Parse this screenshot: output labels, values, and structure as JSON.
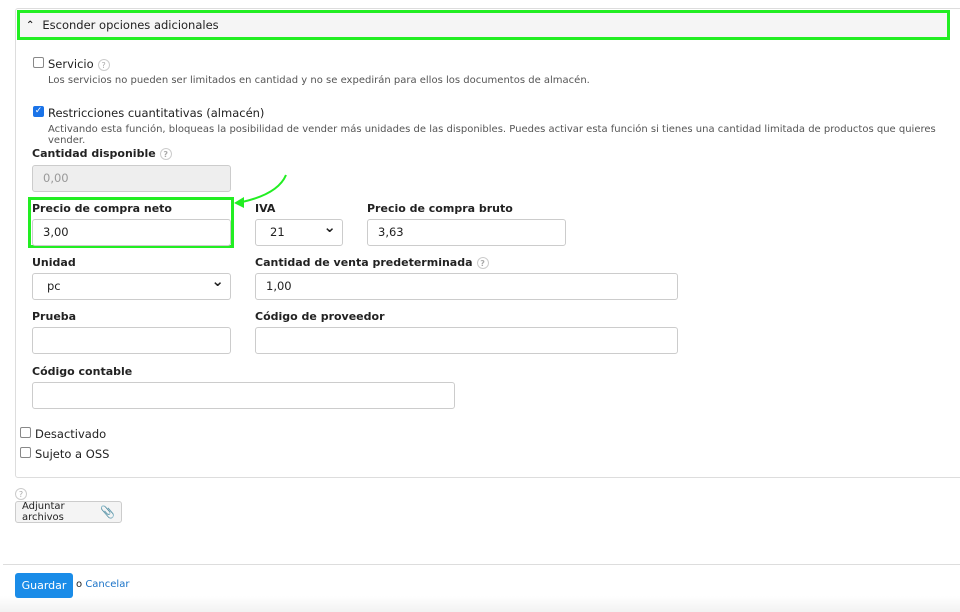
{
  "section": {
    "toggle_label": "Esconder opciones adicionales"
  },
  "servicio": {
    "label": "Servicio",
    "checked": false,
    "description": "Los servicios no pueden ser limitados en cantidad y no se expedirán para ellos los documentos de almacén."
  },
  "restricciones": {
    "label": "Restricciones cuantitativas (almacén)",
    "checked": true,
    "description": "Activando esta función, bloqueas la posibilidad de vender más unidades de las disponibles. Puedes activar esta función si tienes una cantidad limitada de productos que quieres vender."
  },
  "fields": {
    "cantidad_disponible": {
      "label": "Cantidad disponible",
      "value": "0,00"
    },
    "precio_neto": {
      "label": "Precio de compra neto",
      "value": "3,00"
    },
    "iva": {
      "label": "IVA",
      "value": "21"
    },
    "precio_bruto": {
      "label": "Precio de compra bruto",
      "value": "3,63"
    },
    "unidad": {
      "label": "Unidad",
      "value": "pc"
    },
    "cantidad_venta": {
      "label": "Cantidad de venta predeterminada",
      "value": "1,00"
    },
    "prueba": {
      "label": "Prueba",
      "value": ""
    },
    "codigo_proveedor": {
      "label": "Código de proveedor",
      "value": ""
    },
    "codigo_contable": {
      "label": "Código contable",
      "value": ""
    }
  },
  "desactivado": {
    "label": "Desactivado",
    "checked": false
  },
  "oss": {
    "label": "Sujeto a OSS",
    "checked": false
  },
  "help_mark": "?",
  "attach_label": "Adjuntar archivos",
  "footer": {
    "save": "Guardar",
    "or": "o",
    "cancel": "Cancelar"
  }
}
